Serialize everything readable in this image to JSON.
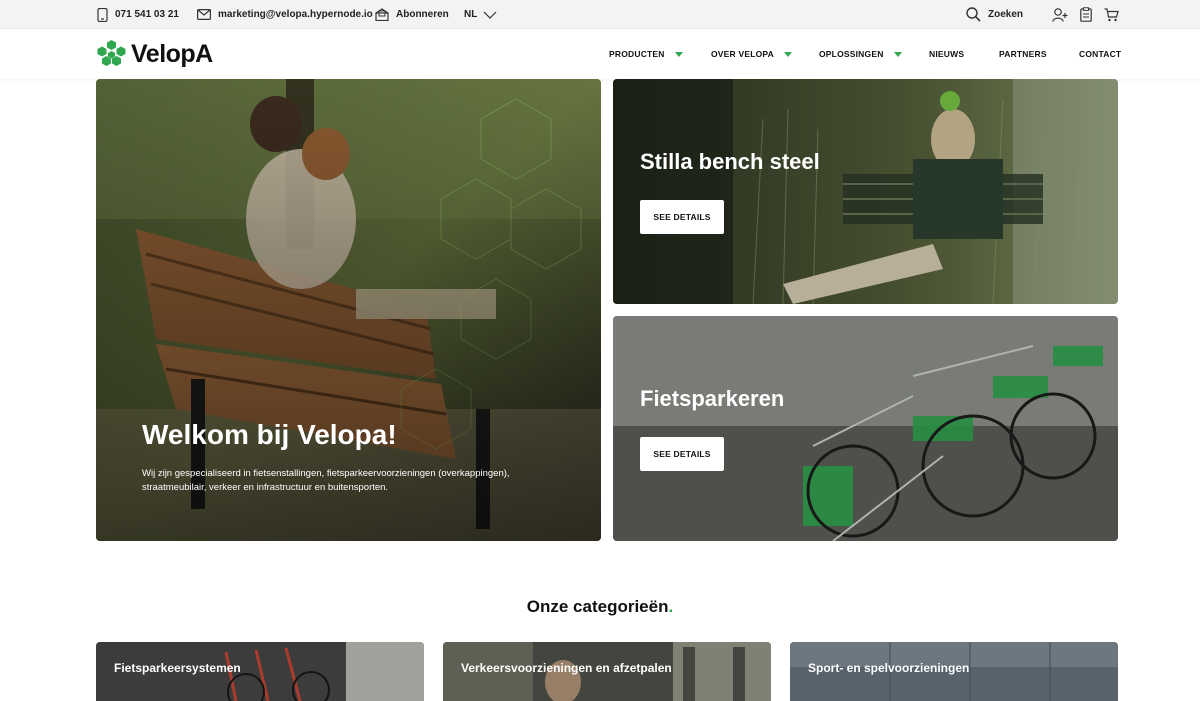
{
  "topbar": {
    "phone": "071 541 03 21",
    "email": "marketing@velopa.hypernode.io",
    "subscribe": "Abonneren",
    "language": "NL",
    "search": "Zoeken",
    "icons": [
      "phone-icon",
      "mail-icon",
      "subscribe-icon",
      "search-icon",
      "user-icon",
      "clipboard-icon",
      "cart-icon"
    ]
  },
  "nav": {
    "logo": "VelopA",
    "items": [
      {
        "label": "PRODUCTEN"
      },
      {
        "label": "OVER VELOPA"
      },
      {
        "label": "OPLOSSINGEN"
      },
      {
        "label": "NIEUWS"
      },
      {
        "label": "PARTNERS"
      },
      {
        "label": "CONTACT"
      }
    ]
  },
  "hero": {
    "main": {
      "title": "Welkom bij Velopa!",
      "text": "Wij zijn gespecialiseerd in fietsenstallingen, fietsparkeervoorzieningen (overkappingen), straatmeubilair, verkeer en infrastructuur en buitensporten."
    },
    "top_right": {
      "title": "Stilla bench steel",
      "button": "SEE DETAILS"
    },
    "bottom_right": {
      "title": "Fietsparkeren",
      "button": "SEE DETAILS"
    }
  },
  "categories": {
    "title": "Onze categorieën",
    "title_dot": ".",
    "items": [
      {
        "label": "Fietsparkeersystemen"
      },
      {
        "label": "Verkeersvoorzieningen en afzetpalen"
      },
      {
        "label": "Sport- en spelvoorzieningen"
      }
    ]
  },
  "colors": {
    "accent": "#2fa84f",
    "topbar": "#f3f4f1"
  }
}
